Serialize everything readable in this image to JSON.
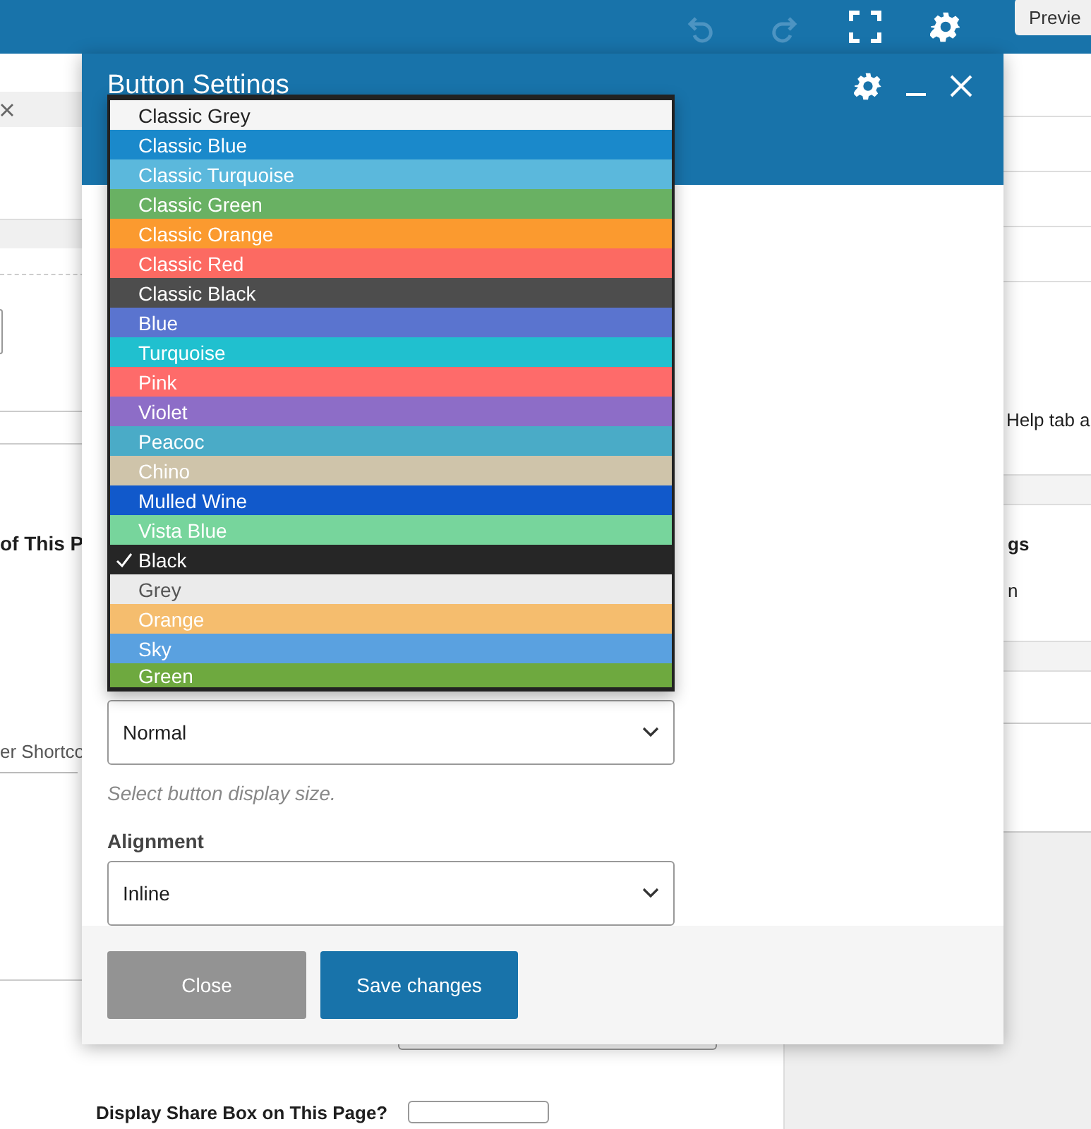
{
  "top_bar": {
    "tools": [
      {
        "kind": "undo",
        "disabled": true
      },
      {
        "kind": "redo",
        "disabled": true
      },
      {
        "kind": "fullscreen",
        "disabled": false
      },
      {
        "kind": "settings",
        "disabled": false
      }
    ],
    "preview_button": "Previe"
  },
  "background_page": {
    "left_texts": [
      "of This P",
      "er Shortco",
      "Display Share Box on This Page?"
    ],
    "right_texts": [
      "Help tab a",
      "gs",
      "n"
    ]
  },
  "modal": {
    "title": "Button Settings",
    "color_list": [
      {
        "label": "Classic Grey",
        "color": "#f5f5f5",
        "selected": false
      },
      {
        "label": "Classic Blue",
        "color": "#1a89cb",
        "selected": false
      },
      {
        "label": "Classic Turquoise",
        "color": "#5bb8dc",
        "selected": false
      },
      {
        "label": "Classic Green",
        "color": "#69b163",
        "selected": false
      },
      {
        "label": "Classic Orange",
        "color": "#fb9a2f",
        "selected": false
      },
      {
        "label": "Classic Red",
        "color": "#fc6a62",
        "selected": false
      },
      {
        "label": "Classic Black",
        "color": "#4d4d4d",
        "selected": false
      },
      {
        "label": "Blue",
        "color": "#5a74cf",
        "selected": false
      },
      {
        "label": "Turquoise",
        "color": "#20c0cf",
        "selected": false
      },
      {
        "label": "Pink",
        "color": "#fe6b6a",
        "selected": false
      },
      {
        "label": "Violet",
        "color": "#8d6dc7",
        "selected": false
      },
      {
        "label": "Peacoc",
        "color": "#4aabc7",
        "selected": false
      },
      {
        "label": "Chino",
        "color": "#cfc4aa",
        "selected": false
      },
      {
        "label": "Mulled Wine",
        "color": "#1159cb",
        "selected": false
      },
      {
        "label": "Vista Blue",
        "color": "#77d59c",
        "selected": false
      },
      {
        "label": "Black",
        "color": "#262626",
        "selected": true
      },
      {
        "label": "Grey",
        "color": "#ebebeb",
        "selected": false
      },
      {
        "label": "Orange",
        "color": "#f5bd6e",
        "selected": false
      },
      {
        "label": "Sky",
        "color": "#5aa1e0",
        "selected": false
      },
      {
        "label": "Green",
        "color": "#6ea93f",
        "selected": false
      }
    ],
    "size_select": {
      "value": "Normal",
      "hint": "Select button display size."
    },
    "alignment": {
      "label": "Alignment",
      "value": "Inline"
    },
    "buttons": [
      {
        "label": "Close",
        "disabled": true
      },
      {
        "label": "Save changes",
        "disabled": false
      }
    ]
  }
}
